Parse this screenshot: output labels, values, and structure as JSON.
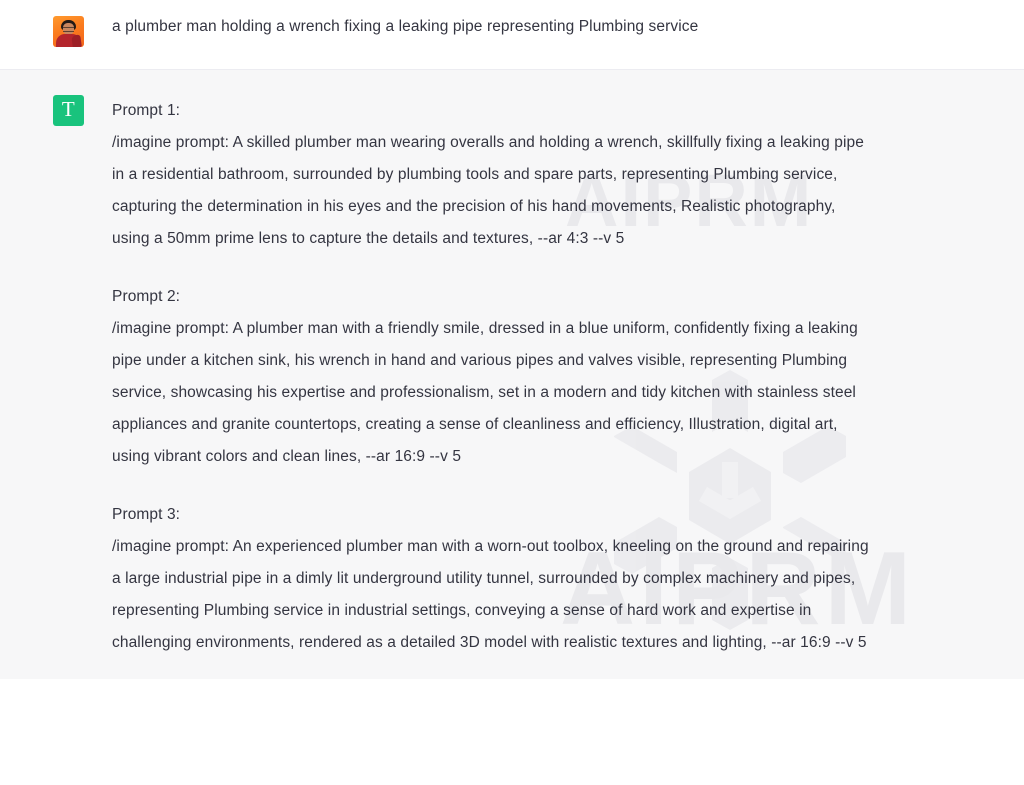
{
  "conversation": {
    "user_message": {
      "avatar_name": "user-avatar-photo",
      "text": "a plumber man holding a wrench fixing a leaking pipe representing Plumbing service"
    },
    "assistant_message": {
      "avatar_letter": "T",
      "avatar_color": "#19c37d",
      "prompts": [
        {
          "heading": "Prompt 1:",
          "body": "/imagine prompt: A skilled plumber man wearing overalls and holding a wrench, skillfully fixing a leaking pipe in a residential bathroom, surrounded by plumbing tools and spare parts, representing Plumbing service, capturing the determination in his eyes and the precision of his hand movements, Realistic photography, using a 50mm prime lens to capture the details and textures, --ar 4:3 --v 5"
        },
        {
          "heading": "Prompt 2:",
          "body": "/imagine prompt: A plumber man with a friendly smile, dressed in a blue uniform, confidently fixing a leaking pipe under a kitchen sink, his wrench in hand and various pipes and valves visible, representing Plumbing service, showcasing his expertise and professionalism, set in a modern and tidy kitchen with stainless steel appliances and granite countertops, creating a sense of cleanliness and efficiency, Illustration, digital art, using vibrant colors and clean lines, --ar 16:9 --v 5"
        },
        {
          "heading": "Prompt 3:",
          "body": "/imagine prompt: An experienced plumber man with a worn-out toolbox, kneeling on the ground and repairing a large industrial pipe in a dimly lit underground utility tunnel, surrounded by complex machinery and pipes, representing Plumbing service in industrial settings, conveying a sense of hard work and expertise in challenging environments, rendered as a detailed 3D model with realistic textures and lighting, --ar 16:9 --v 5"
        }
      ]
    }
  },
  "watermark": {
    "brand_text": "AIPRM",
    "logo_name": "aiprm-logo",
    "color": "#e9e9ec"
  },
  "theme": {
    "user_background": "#ffffff",
    "assistant_background": "#f7f7f8",
    "text_color": "#343541",
    "divider_color": "#ececf1"
  }
}
